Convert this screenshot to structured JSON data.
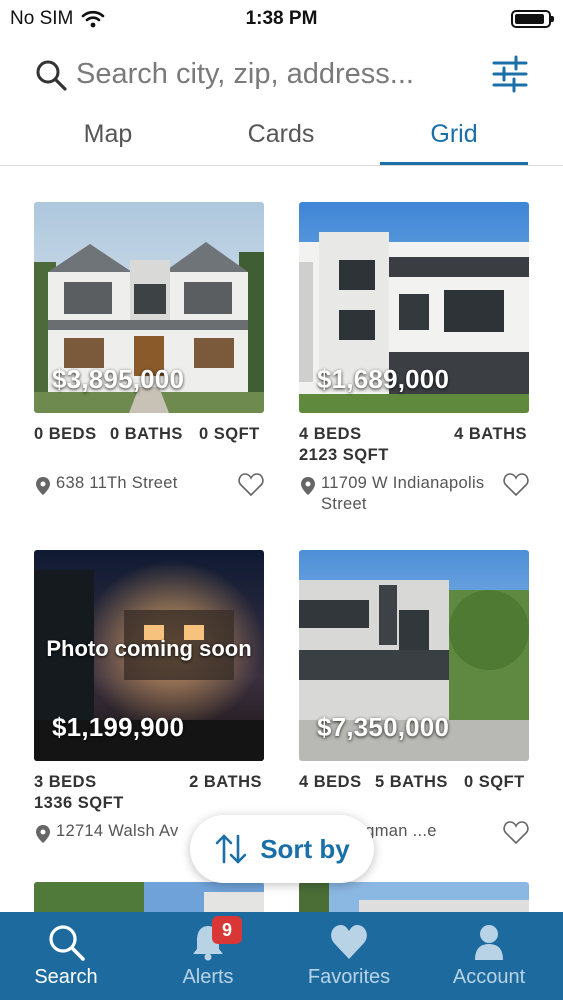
{
  "status_bar": {
    "carrier": "No SIM",
    "time": "1:38 PM",
    "battery_level": 0.9
  },
  "search": {
    "placeholder": "Search city, zip, address..."
  },
  "view_tabs": [
    {
      "label": "Map",
      "active": false
    },
    {
      "label": "Cards",
      "active": false
    },
    {
      "label": "Grid",
      "active": true
    }
  ],
  "listings": [
    {
      "price": "$3,895,000",
      "beds": "0 BEDS",
      "baths": "0 BATHS",
      "sqft": "0 SQFT",
      "address": "638 11Th Street",
      "photo_overlay": ""
    },
    {
      "price": "$1,689,000",
      "beds": "4 BEDS",
      "baths": "4 BATHS",
      "sqft": "2123 SQFT",
      "address": "11709 W Indianapolis Street",
      "photo_overlay": ""
    },
    {
      "price": "$1,199,900",
      "beds": "3 BEDS",
      "baths": "2 BATHS",
      "sqft": "1336 SQFT",
      "address": "12714 Walsh Av",
      "photo_overlay": "Photo coming soon"
    },
    {
      "price": "$7,350,000",
      "beds": "4 BEDS",
      "baths": "5 BATHS",
      "sqft": "0 SQFT",
      "address": "... Kingman ...e",
      "photo_overlay": ""
    }
  ],
  "sort_button": {
    "label": "Sort by"
  },
  "bottom_tabs": [
    {
      "label": "Search",
      "icon": "search-icon",
      "active": true
    },
    {
      "label": "Alerts",
      "icon": "bell-icon",
      "active": false,
      "badge": "9"
    },
    {
      "label": "Favorites",
      "icon": "heart-icon",
      "active": false
    },
    {
      "label": "Account",
      "icon": "person-icon",
      "active": false
    }
  ],
  "colors": {
    "accent": "#1b6fa8",
    "tabbar": "#1c6a9e",
    "badge": "#d93636"
  }
}
